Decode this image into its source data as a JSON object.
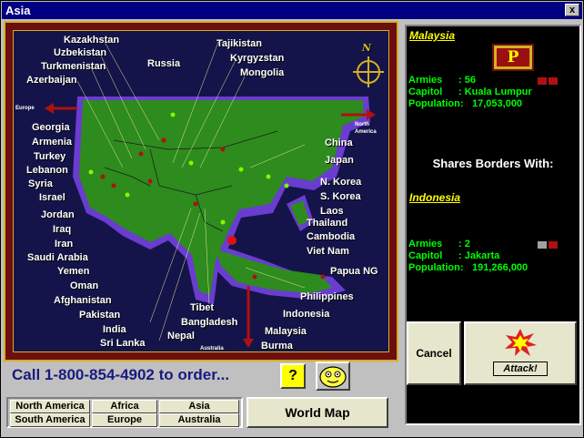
{
  "window": {
    "title": "Asia",
    "close_label": "x"
  },
  "map": {
    "edge_labels": {
      "europe": "Europe",
      "north_america_1": "North",
      "north_america_2": "America",
      "australia": "Australia"
    },
    "compass_label": "N",
    "countries_left": [
      "Kazakhstan",
      "Uzbekistan",
      "Turkmenistan",
      "Azerbaijan",
      "Georgia",
      "Armenia",
      "Turkey",
      "Lebanon",
      "Syria",
      "Israel",
      "Jordan",
      "Iraq",
      "Iran",
      "Saudi Arabia",
      "Yemen",
      "Oman",
      "Afghanistan",
      "Pakistan",
      "India",
      "Sri Lanka"
    ],
    "countries_right": [
      "Russia",
      "Tajikistan",
      "Kyrgyzstan",
      "Mongolia",
      "China",
      "Japan",
      "N. Korea",
      "S. Korea",
      "Laos",
      "Thailand",
      "Cambodia",
      "Viet Nam",
      "Papua NG",
      "Philippines",
      "Indonesia",
      "Malaysia",
      "Burma",
      "Tibet",
      "Bangladesh",
      "Nepal"
    ]
  },
  "selected": {
    "name": "Malaysia",
    "flag_glyph": "P",
    "armies_label": "Armies",
    "armies_value": ": 56",
    "capitol_label": "Capitol",
    "capitol_value": ": Kuala Lumpur",
    "population_label": "Population:",
    "population_value": "17,053,000"
  },
  "shares_title": "Shares Borders With:",
  "neighbor": {
    "name": "Indonesia",
    "armies_label": "Armies",
    "armies_value": ": 2",
    "capitol_label": "Capitol",
    "capitol_value": ": Jakarta",
    "population_label": "Population:",
    "population_value": "191,266,000"
  },
  "buttons": {
    "cancel": "Cancel",
    "attack": "Attack!",
    "help": "?",
    "world_map": "World Map"
  },
  "order_text": "Call 1-800-854-4902 to order...",
  "regions": [
    "North America",
    "Africa",
    "Asia",
    "South America",
    "Europe",
    "Australia"
  ],
  "colors": {
    "land": "#2e8b1e",
    "shore": "#6a3ccf",
    "ocean": "#14144a",
    "frame": "#6b0f10",
    "gold": "#d4b020",
    "stat": "#00ff00",
    "title": "#ffff00"
  }
}
